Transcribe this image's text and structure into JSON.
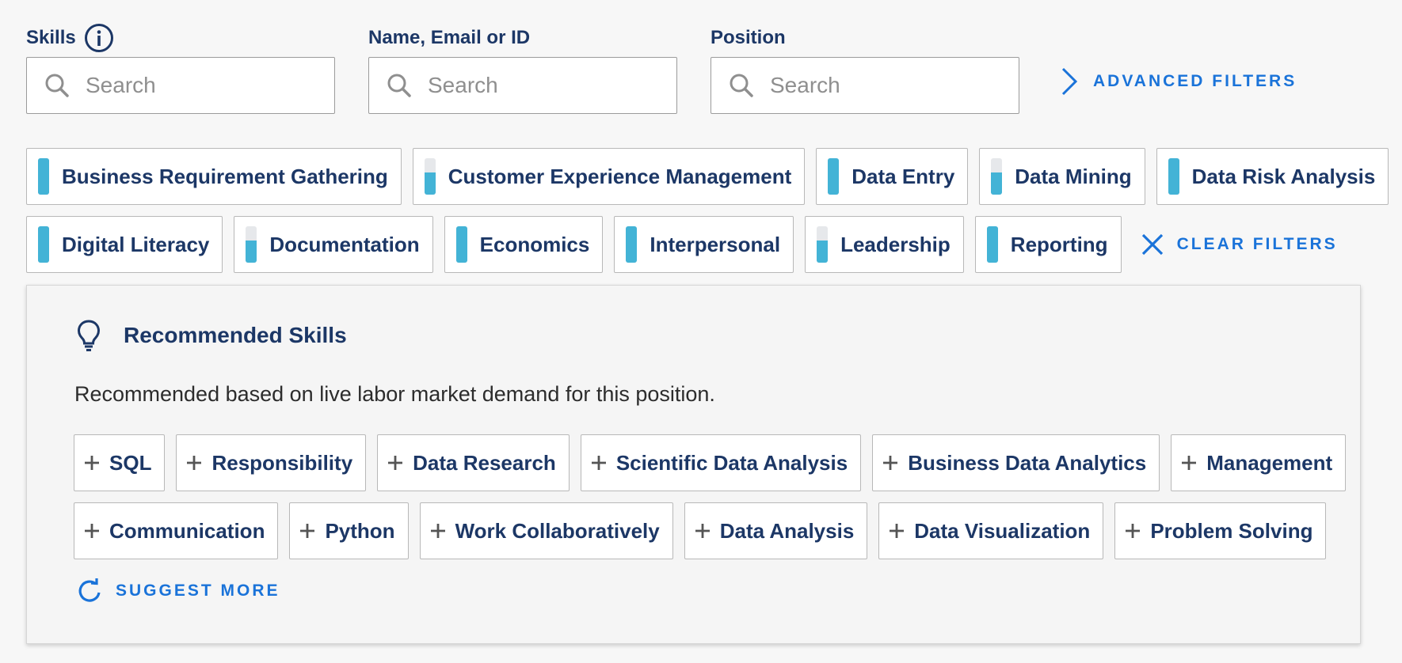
{
  "filters": {
    "skills": {
      "label": "Skills",
      "placeholder": "Search"
    },
    "name": {
      "label": "Name, Email or ID",
      "placeholder": "Search"
    },
    "position": {
      "label": "Position",
      "placeholder": "Search"
    },
    "advanced_label": "ADVANCED FILTERS",
    "clear_label": "CLEAR FILTERS"
  },
  "selected_skills": [
    {
      "label": "Business Requirement Gathering",
      "level": 1.0
    },
    {
      "label": "Customer Experience Management",
      "level": 0.6
    },
    {
      "label": "Data Entry",
      "level": 1.0
    },
    {
      "label": "Data Mining",
      "level": 0.6
    },
    {
      "label": "Data Risk Analysis",
      "level": 1.0
    },
    {
      "label": "Digital Literacy",
      "level": 1.0
    },
    {
      "label": "Documentation",
      "level": 0.6
    },
    {
      "label": "Economics",
      "level": 1.0
    },
    {
      "label": "Interpersonal",
      "level": 1.0
    },
    {
      "label": "Leadership",
      "level": 0.6
    },
    {
      "label": "Reporting",
      "level": 1.0
    }
  ],
  "recommended": {
    "title": "Recommended Skills",
    "description": "Recommended based on live labor market demand for this position.",
    "skills": [
      "SQL",
      "Responsibility",
      "Data Research",
      "Scientific Data Analysis",
      "Business Data Analytics",
      "Management",
      "Communication",
      "Python",
      "Work Collaboratively",
      "Data Analysis",
      "Data Visualization",
      "Problem Solving"
    ],
    "suggest_more_label": "SUGGEST MORE"
  },
  "colors": {
    "navy": "#1c3766",
    "link_blue": "#1a73d9",
    "level_fill": "#43b3d6",
    "level_track": "#e6e8eb"
  },
  "icons": {
    "info": "info-circle-icon",
    "search": "magnifier-icon",
    "advanced": "chevron-right-icon",
    "clear": "close-x-icon",
    "recommend": "lightbulb-icon",
    "add": "plus-icon",
    "suggest": "refresh-icon"
  }
}
